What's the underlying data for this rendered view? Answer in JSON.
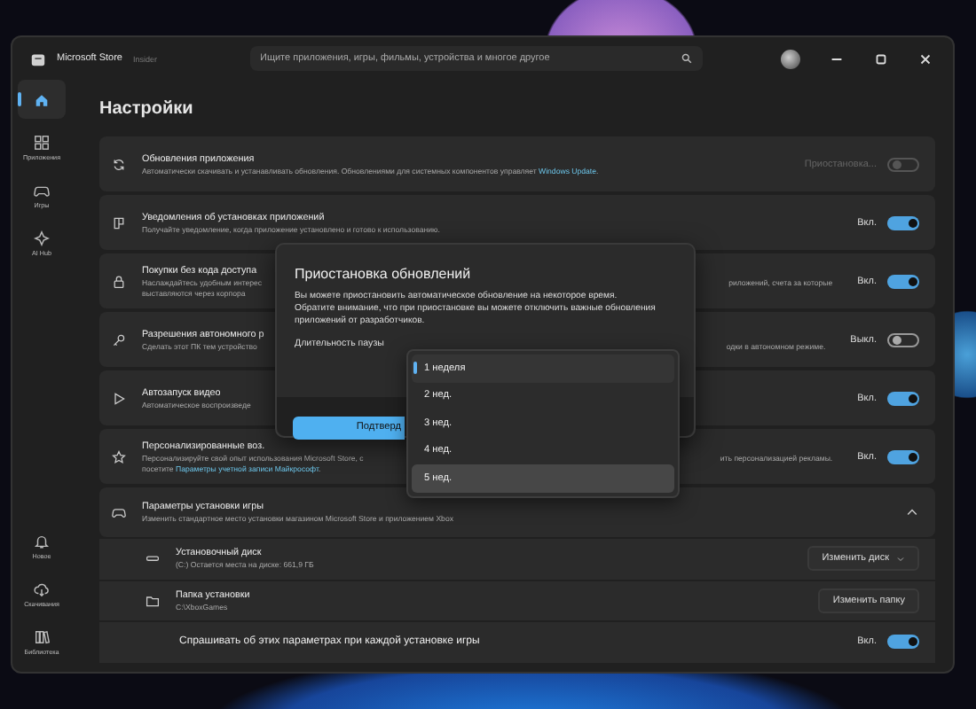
{
  "window": {
    "app_name": "Microsoft Store",
    "badge": "Insider"
  },
  "search": {
    "placeholder": "Ищите приложения, игры, фильмы, устройства и многое другое"
  },
  "sidebar": {
    "top_items": [
      {
        "selected": true
      },
      {
        "label": "Приложения",
        "selected": false
      },
      {
        "label": "Игры",
        "selected": false
      },
      {
        "label": "AI Hub",
        "selected": false
      }
    ],
    "bottom_items": [
      {
        "label": "Новое",
        "selected": false
      },
      {
        "label": "Скачивания",
        "selected": false
      },
      {
        "label": "Библиотека",
        "selected": false
      }
    ]
  },
  "page_title": "Настройки",
  "settings": [
    {
      "title": "Обновления приложения",
      "lines": [
        {
          "left": [
            {
              "text": "Автоматически скачивать и устанавливать обновления. Обновлениями для системных компонентов управляет "
            },
            {
              "text": "Windows Update",
              "link": true
            },
            {
              "text": "."
            }
          ]
        }
      ],
      "state_label": "Приостановка...",
      "on": false,
      "disabled": true
    },
    {
      "title": "Уведомления об установках приложений",
      "lines": [
        {
          "left": [
            {
              "text": "Получайте уведомление, когда приложение установлено и готово к использованию."
            }
          ]
        }
      ],
      "state_label": "Вкл.",
      "on": true,
      "disabled": false
    },
    {
      "title": "Покупки без кода доступа",
      "lines": [
        {
          "left": [
            {
              "text": "Наслаждайтесь удобным интерес"
            }
          ],
          "right": [
            {
              "text": "риложений, счета за которые"
            }
          ]
        },
        {
          "left": [
            {
              "text": "выставляются через корпора"
            }
          ]
        }
      ],
      "state_label": "Вкл.",
      "on": true,
      "disabled": false
    },
    {
      "title": "Разрешения автономного р",
      "lines": [
        {
          "left": [
            {
              "text": "Сделать этот ПК тем устройство"
            }
          ],
          "right": [
            {
              "text": "одки в автономном режиме."
            }
          ]
        }
      ],
      "state_label": "Выкл.",
      "on": false,
      "disabled": false
    },
    {
      "title": "Автозапуск видео",
      "lines": [
        {
          "left": [
            {
              "text": "Автоматическое воспроизведе"
            }
          ]
        }
      ],
      "state_label": "Вкл.",
      "on": true,
      "disabled": false
    },
    {
      "title": "Персонализированные воз.",
      "lines": [
        {
          "left": [
            {
              "text": "Персонализируйте свой опыт использования Microsoft Store, с"
            }
          ],
          "right": [
            {
              "text": "ить персонализацией рекламы."
            }
          ]
        },
        {
          "left": [
            {
              "text": "посетите "
            },
            {
              "text": "Параметры учетной записи Майкрософт",
              "link": true
            },
            {
              "text": "."
            }
          ]
        }
      ],
      "state_label": "Вкл.",
      "on": true,
      "disabled": false
    }
  ],
  "game_install": {
    "title": "Параметры установки игры",
    "description": "Изменить стандартное место установки магазином Microsoft Store и приложением Xbox",
    "expanded": true,
    "rows": [
      {
        "kind": "drive",
        "title": "Установочный диск",
        "subtitle": "(C:) Остается места на диске: 661,9 ГБ",
        "button": "Изменить диск"
      },
      {
        "kind": "folder",
        "title": "Папка установки",
        "subtitle": "C:\\XboxGames",
        "button": "Изменить папку"
      },
      {
        "kind": "toggle",
        "title": "Спрашивать об этих параметрах при каждой установке игры",
        "state_label": "Вкл.",
        "on": true
      }
    ]
  },
  "dialog": {
    "title": "Приостановка обновлений",
    "body": "Вы можете приостановить автоматическое обновление на некоторое время. Обратите внимание, что при приостановке вы можете отключить важные обновления приложений от разработчиков.",
    "field_label": "Длительность паузы",
    "confirm": "Подтверд",
    "options": [
      {
        "label": "1 неделя",
        "selected": true,
        "highlighted": false
      },
      {
        "label": "2 нед.",
        "selected": false,
        "highlighted": false
      },
      {
        "label": "3 нед.",
        "selected": false,
        "highlighted": false
      },
      {
        "label": "4 нед.",
        "selected": false,
        "highlighted": false
      },
      {
        "label": "5 нед.",
        "selected": false,
        "highlighted": true
      }
    ]
  }
}
